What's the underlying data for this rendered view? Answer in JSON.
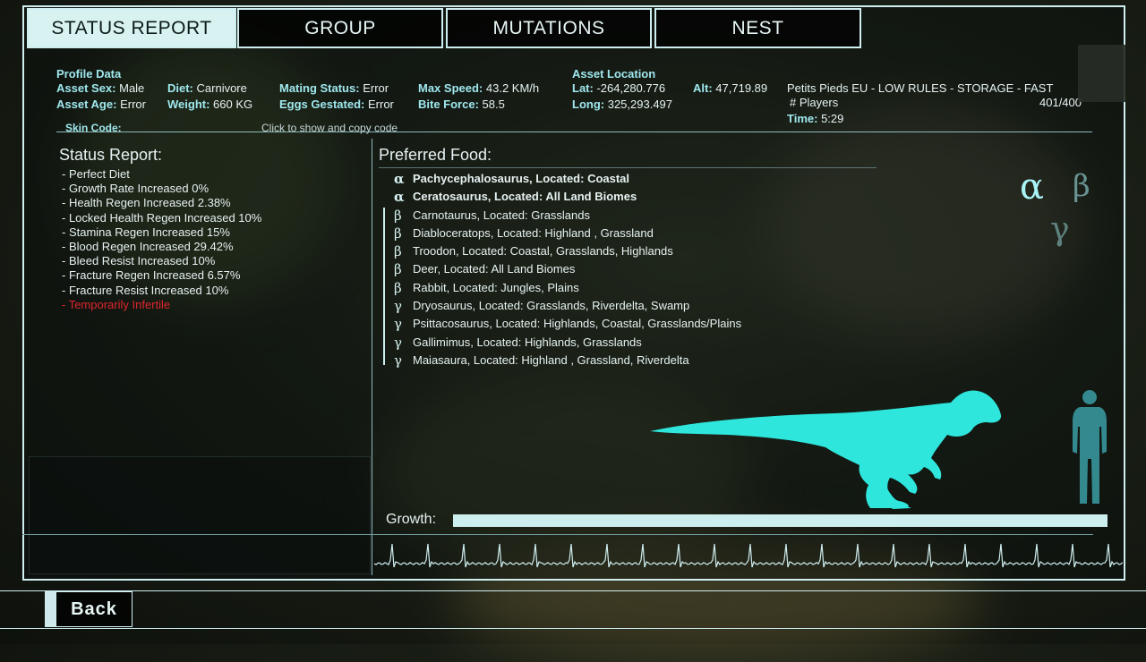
{
  "tabs": [
    "STATUS REPORT",
    "GROUP",
    "MUTATIONS",
    "NEST"
  ],
  "profile": {
    "heading": "Profile Data",
    "sex_label": "Asset Sex:",
    "sex": "Male",
    "age_label": "Asset Age:",
    "age": "Error",
    "diet_label": "Diet:",
    "diet": "Carnivore",
    "weight_label": "Weight:",
    "weight": "660  KG",
    "mating_label": "Mating Status:",
    "mating": "Error",
    "eggs_label": "Eggs Gestated:",
    "eggs": "Error",
    "speed_label": "Max Speed:",
    "speed": "43.2  KM/h",
    "bite_label": "Bite Force:",
    "bite": "58.5"
  },
  "location": {
    "heading": "Asset Location",
    "lat_label": "Lat:",
    "lat": "-264,280.776",
    "long_label": "Long:",
    "long": "325,293.497",
    "alt_label": "Alt:",
    "alt": "47,719.89"
  },
  "server": {
    "name": "Petits Pieds EU - LOW RULES - STORAGE - FAST",
    "players_label": "# Players",
    "players": "401/400",
    "time_label": "Time:",
    "time": "5:29"
  },
  "skin": {
    "label": "Skin Code:",
    "action": "Click to show and copy code"
  },
  "status_report": {
    "title": "Status  Report:",
    "items": [
      "- Perfect Diet",
      "- Growth Rate Increased 0%",
      "- Health Regen Increased 2.38%",
      "- Locked Health Regen Increased 10%",
      "- Stamina Regen Increased 15%",
      "- Blood Regen Increased 29.42%",
      "- Bleed Resist Increased 10%",
      "- Fracture Regen Increased 6.57%",
      "- Fracture Resist Increased 10%",
      "- Temporarily Infertile"
    ]
  },
  "preferred_food": {
    "title": "Preferred Food:",
    "items": [
      {
        "tier": "α",
        "text": "Pachycephalosaurus, Located: Coastal"
      },
      {
        "tier": "α",
        "text": "Ceratosaurus, Located: All Land Biomes"
      },
      {
        "tier": "β",
        "text": "Carnotaurus, Located: Grasslands"
      },
      {
        "tier": "β",
        "text": "Diabloceratops, Located: Highland , Grassland"
      },
      {
        "tier": "β",
        "text": "Troodon, Located: Coastal, Grasslands, Highlands"
      },
      {
        "tier": "β",
        "text": "Deer, Located: All Land Biomes"
      },
      {
        "tier": "β",
        "text": "Rabbit, Located: Jungles, Plains"
      },
      {
        "tier": "γ",
        "text": "Dryosaurus, Located: Grasslands, Riverdelta, Swamp"
      },
      {
        "tier": "γ",
        "text": "Psittacosaurus, Located: Highlands, Coastal, Grasslands/Plains"
      },
      {
        "tier": "γ",
        "text": "Gallimimus, Located: Highlands, Grasslands"
      },
      {
        "tier": "γ",
        "text": "Maiasaura, Located: Highland , Grassland, Riverdelta"
      }
    ]
  },
  "tier_legend": {
    "alpha": "α",
    "beta": "β",
    "gamma": "γ"
  },
  "growth": {
    "label": "Growth:",
    "value": 1.0
  },
  "back_label": "Back",
  "colors": {
    "accent": "#cfeef0",
    "silhouette": "#2ee6dc",
    "warning": "#e0242c"
  }
}
